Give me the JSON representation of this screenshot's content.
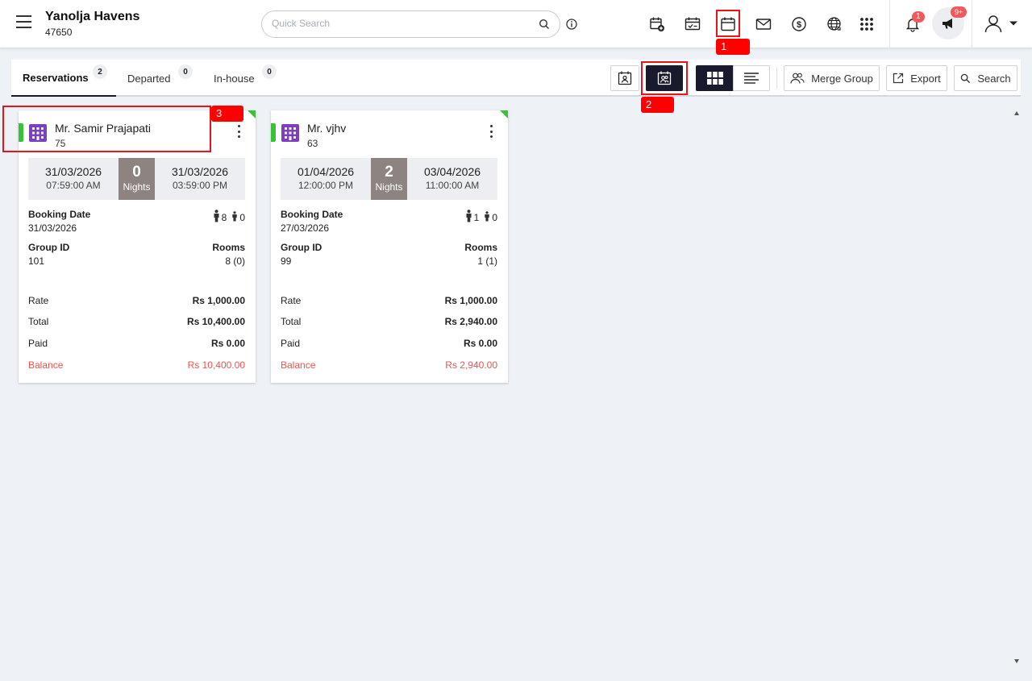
{
  "header": {
    "hotel_name": "Yanolja Havens",
    "hotel_code": "47650",
    "search_placeholder": "Quick Search",
    "notification_count": "1",
    "announcement_count": "9+"
  },
  "icons": {
    "menu": "hamburger-icon",
    "search": "search-icon",
    "info": "info-icon",
    "new_reservation": "calendar-plus-icon",
    "checkin": "calendar-check-icon",
    "calendar": "calendar-icon",
    "mail": "mail-icon",
    "currency": "dollar-icon",
    "globe": "globe-icon",
    "apps": "grid-apps-icon",
    "bell": "bell-icon",
    "announcement": "megaphone-icon",
    "user": "user-icon"
  },
  "annotations": [
    "1",
    "2",
    "3"
  ],
  "tabs": [
    {
      "label": "Reservations",
      "count": "2"
    },
    {
      "label": "Departed",
      "count": "0"
    },
    {
      "label": "In-house",
      "count": "0"
    }
  ],
  "toolbar": {
    "merge_group": "Merge Group",
    "export": "Export",
    "search": "Search"
  },
  "labels": {
    "nights": "Nights",
    "booking_date": "Booking Date",
    "group_id": "Group ID",
    "rooms": "Rooms",
    "rate": "Rate",
    "total": "Total",
    "paid": "Paid",
    "balance": "Balance"
  },
  "cards": [
    {
      "guest_name": "Mr. Samir Prajapati",
      "guest_number": "75",
      "arrival_date": "31/03/2026",
      "arrival_time": "07:59:00 AM",
      "nights": "0",
      "departure_date": "31/03/2026",
      "departure_time": "03:59:00 PM",
      "booking_date": "31/03/2026",
      "adults": "8",
      "children": "0",
      "group_id": "101",
      "rooms": "8 (0)",
      "rate": "Rs 1,000.00",
      "total": "Rs 10,400.00",
      "paid": "Rs 0.00",
      "balance": "Rs 10,400.00"
    },
    {
      "guest_name": "Mr. vjhv",
      "guest_number": "63",
      "arrival_date": "01/04/2026",
      "arrival_time": "12:00:00 PM",
      "nights": "2",
      "departure_date": "03/04/2026",
      "departure_time": "11:00:00 AM",
      "booking_date": "27/03/2026",
      "adults": "1",
      "children": "0",
      "group_id": "99",
      "rooms": "1 (1)",
      "rate": "Rs 1,000.00",
      "total": "Rs 2,940.00",
      "paid": "Rs 0.00",
      "balance": "Rs 2,940.00"
    }
  ],
  "colors": {
    "accent_dark": "#1a1a2e",
    "status_green": "#37c337",
    "balance_red": "#f0524f",
    "nights_bg": "#8d8481",
    "building_purple": "#7b3fbf",
    "annotation_red": "#ff0000"
  }
}
